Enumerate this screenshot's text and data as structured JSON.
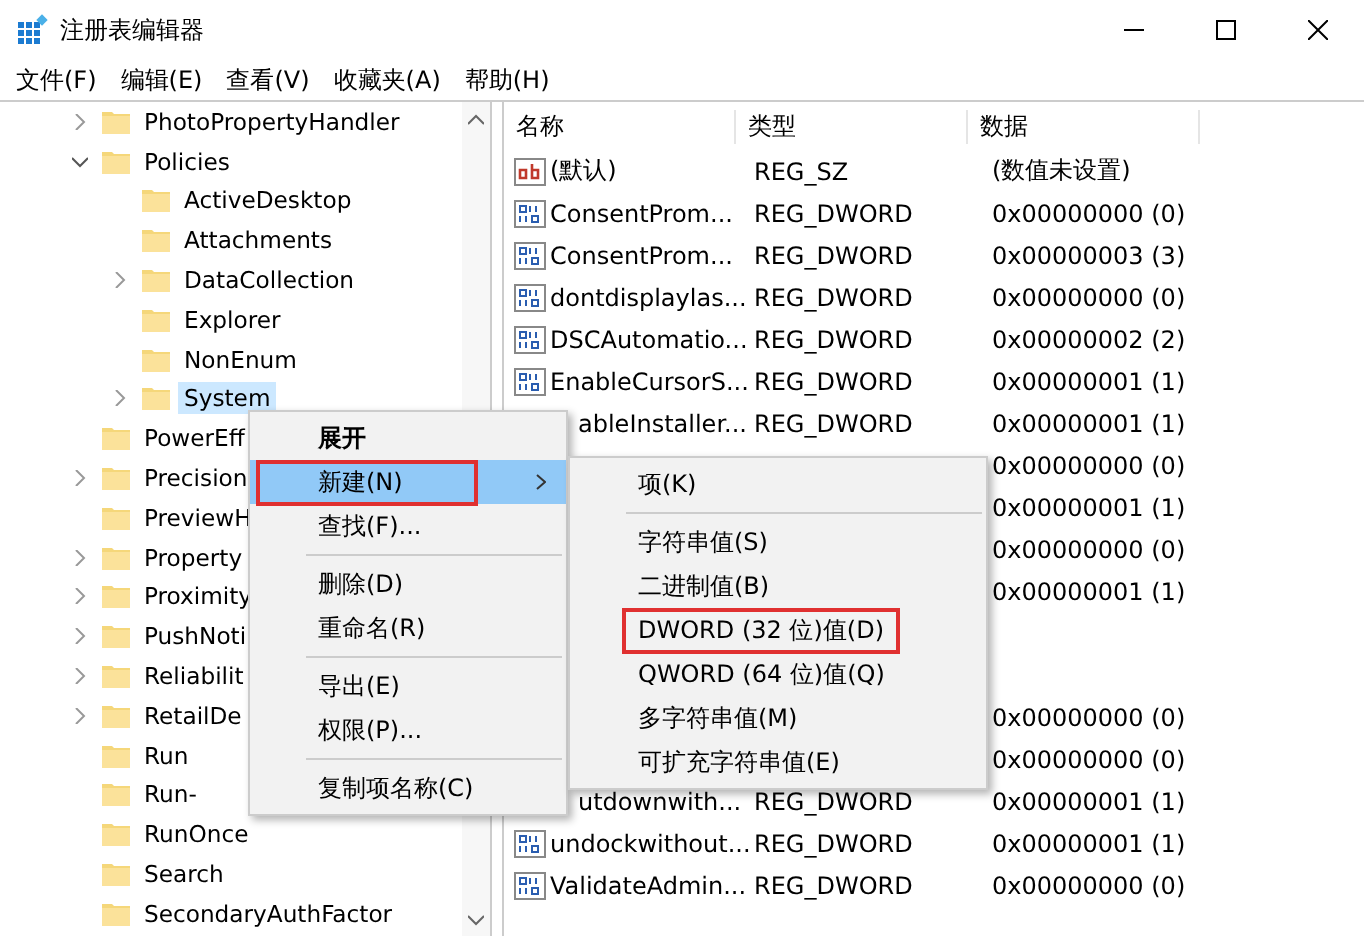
{
  "window": {
    "title": "注册表编辑器"
  },
  "menu_bar": [
    "文件(F)",
    "编辑(E)",
    "查看(V)",
    "收藏夹(A)",
    "帮助(H)"
  ],
  "tree": [
    {
      "label": "PhotoPropertyHandler",
      "expanded": false,
      "selected": false
    },
    {
      "label": "Policies",
      "expanded": true,
      "selected": false,
      "children": [
        {
          "label": "ActiveDesktop",
          "selected": false
        },
        {
          "label": "Attachments",
          "selected": false
        },
        {
          "label": "DataCollection",
          "expanded": false,
          "selected": false
        },
        {
          "label": "Explorer",
          "selected": false
        },
        {
          "label": "NonEnum",
          "selected": false
        },
        {
          "label": "System",
          "expanded": false,
          "selected": true
        }
      ]
    },
    {
      "label": "PowerEff",
      "selected": false
    },
    {
      "label": "Precision",
      "expanded": false,
      "selected": false
    },
    {
      "label": "PreviewH",
      "selected": false
    },
    {
      "label": "Property",
      "expanded": false,
      "selected": false
    },
    {
      "label": "Proximity",
      "expanded": false,
      "selected": false
    },
    {
      "label": "PushNoti",
      "expanded": false,
      "selected": false
    },
    {
      "label": "Reliabilit",
      "expanded": false,
      "selected": false
    },
    {
      "label": "RetailDe",
      "expanded": false,
      "selected": false
    },
    {
      "label": "Run",
      "selected": false
    },
    {
      "label": "Run-",
      "selected": false
    },
    {
      "label": "RunOnce",
      "selected": false
    },
    {
      "label": "Search",
      "selected": false
    },
    {
      "label": "SecondaryAuthFactor",
      "selected": false
    }
  ],
  "table": {
    "columns": [
      "名称",
      "类型",
      "数据"
    ],
    "rows": [
      {
        "kind": "string",
        "name": "(默认)",
        "type": "REG_SZ",
        "data": "(数值未设置)"
      },
      {
        "kind": "dword",
        "name": "ConsentProm...",
        "type": "REG_DWORD",
        "data": "0x00000000 (0)"
      },
      {
        "kind": "dword",
        "name": "ConsentProm...",
        "type": "REG_DWORD",
        "data": "0x00000003 (3)"
      },
      {
        "kind": "dword",
        "name": "dontdisplaylas...",
        "type": "REG_DWORD",
        "data": "0x00000000 (0)"
      },
      {
        "kind": "dword",
        "name": "DSCAutomatio...",
        "type": "REG_DWORD",
        "data": "0x00000002 (2)"
      },
      {
        "kind": "dword",
        "name": "EnableCursorS...",
        "type": "REG_DWORD",
        "data": "0x00000001 (1)"
      },
      {
        "kind": "hidden",
        "name": "ableInstaller...",
        "type": "REG_DWORD",
        "data": "0x00000001 (1)"
      },
      {
        "kind": "hidden",
        "data": "0x00000000 (0)"
      },
      {
        "kind": "hidden",
        "data": "0x00000001 (1)"
      },
      {
        "kind": "hidden",
        "data": "0x00000000 (0)"
      },
      {
        "kind": "hidden",
        "data": "0x00000001 (1)"
      },
      {
        "kind": "hidden"
      },
      {
        "kind": "hidden"
      },
      {
        "kind": "hidden",
        "data": "0x00000000 (0)"
      },
      {
        "kind": "hidden",
        "data": "0x00000000 (0)"
      },
      {
        "kind": "hidden",
        "name": "utdownwith...",
        "type": "REG_DWORD",
        "data": "0x00000001 (1)"
      },
      {
        "kind": "dword",
        "name": "undockwithout...",
        "type": "REG_DWORD",
        "data": "0x00000001 (1)"
      },
      {
        "kind": "dword",
        "name": "ValidateAdmin...",
        "type": "REG_DWORD",
        "data": "0x00000000 (0)"
      }
    ]
  },
  "context_menu": {
    "items": [
      {
        "kind": "item",
        "label": "展开",
        "bold": true,
        "selected": false,
        "annotated": false,
        "submenu": false
      },
      {
        "kind": "item",
        "label": "新建(N)",
        "bold": false,
        "selected": true,
        "annotated": true,
        "submenu": true
      },
      {
        "kind": "item",
        "label": "查找(F)...",
        "bold": false,
        "selected": false,
        "annotated": false,
        "submenu": false
      },
      {
        "kind": "separator"
      },
      {
        "kind": "item",
        "label": "删除(D)",
        "bold": false,
        "selected": false,
        "annotated": false,
        "submenu": false
      },
      {
        "kind": "item",
        "label": "重命名(R)",
        "bold": false,
        "selected": false,
        "annotated": false,
        "submenu": false
      },
      {
        "kind": "separator"
      },
      {
        "kind": "item",
        "label": "导出(E)",
        "bold": false,
        "selected": false,
        "annotated": false,
        "submenu": false
      },
      {
        "kind": "item",
        "label": "权限(P)...",
        "bold": false,
        "selected": false,
        "annotated": false,
        "submenu": false
      },
      {
        "kind": "separator"
      },
      {
        "kind": "item",
        "label": "复制项名称(C)",
        "bold": false,
        "selected": false,
        "annotated": false,
        "submenu": false
      }
    ]
  },
  "submenu": {
    "items": [
      {
        "kind": "item",
        "label": "项(K)",
        "annotated": false
      },
      {
        "kind": "separator"
      },
      {
        "kind": "item",
        "label": "字符串值(S)",
        "annotated": false
      },
      {
        "kind": "item",
        "label": "二进制值(B)",
        "annotated": false
      },
      {
        "kind": "item",
        "label": "DWORD (32 位)值(D)",
        "annotated": true
      },
      {
        "kind": "item",
        "label": "QWORD (64 位)值(Q)",
        "annotated": false
      },
      {
        "kind": "item",
        "label": "多字符串值(M)",
        "annotated": false
      },
      {
        "kind": "item",
        "label": "可扩充字符串值(E)",
        "annotated": false
      }
    ]
  }
}
